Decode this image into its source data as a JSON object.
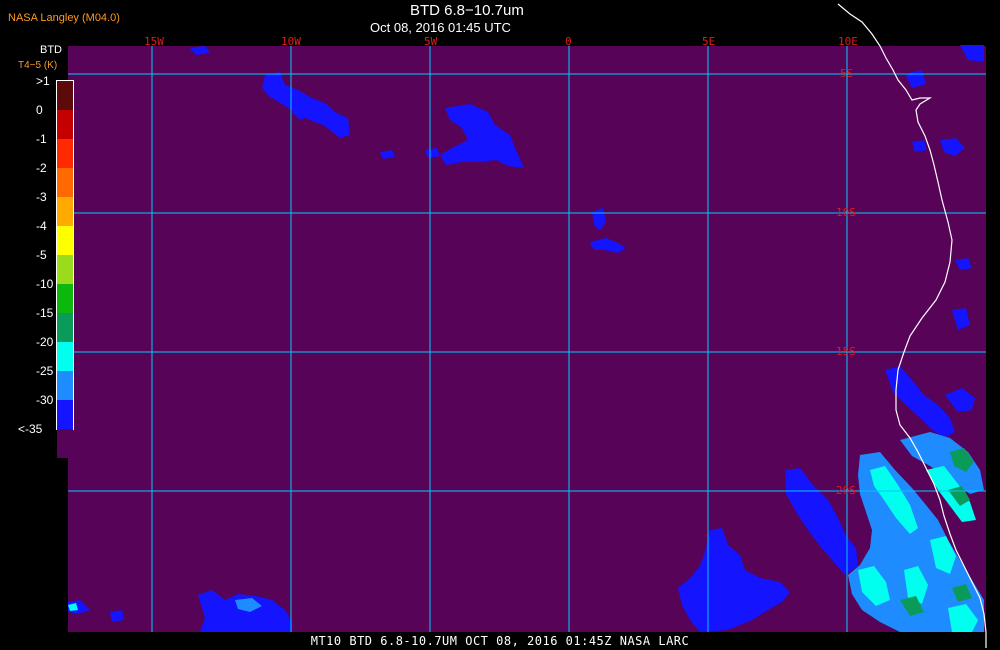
{
  "header": {
    "producer": "NASA Langley (M04.0)",
    "title": "BTD 6.8−10.7um",
    "datetime": "Oct 08, 2016 01:45 UTC"
  },
  "legend": {
    "title": "BTD",
    "unit": "T4−5 (K)",
    "entries": [
      {
        "label": ">1",
        "color": "#5c0a0a"
      },
      {
        "label": "0",
        "color": "#c40000"
      },
      {
        "label": "-1",
        "color": "#ff2a00"
      },
      {
        "label": "-2",
        "color": "#ff6a00"
      },
      {
        "label": "-3",
        "color": "#ffaa00"
      },
      {
        "label": "-4",
        "color": "#ffff00"
      },
      {
        "label": "-5",
        "color": "#9adc1c"
      },
      {
        "label": "-10",
        "color": "#0cb80c"
      },
      {
        "label": "-15",
        "color": "#0a9a5a"
      },
      {
        "label": "-20",
        "color": "#00ffee"
      },
      {
        "label": "-25",
        "color": "#1e8cff"
      },
      {
        "label": "-30",
        "color": "#1414ff"
      },
      {
        "label": "<-35",
        "color": "#570357"
      }
    ]
  },
  "graticule": {
    "longitudes": [
      "15W",
      "10W",
      "5W",
      "0",
      "5E",
      "10E"
    ],
    "latitudes": [
      "5S",
      "10S",
      "15S",
      "20S"
    ]
  },
  "colors": {
    "background": "#570357",
    "grid": "#00c8ff",
    "coast": "#ffffff",
    "label_red": "#e01c1c",
    "label_orange": "#ff9a1e"
  },
  "footer": "MT10  BTD 6.8-10.7UM   OCT 08, 2016 01:45Z   NASA LARC"
}
